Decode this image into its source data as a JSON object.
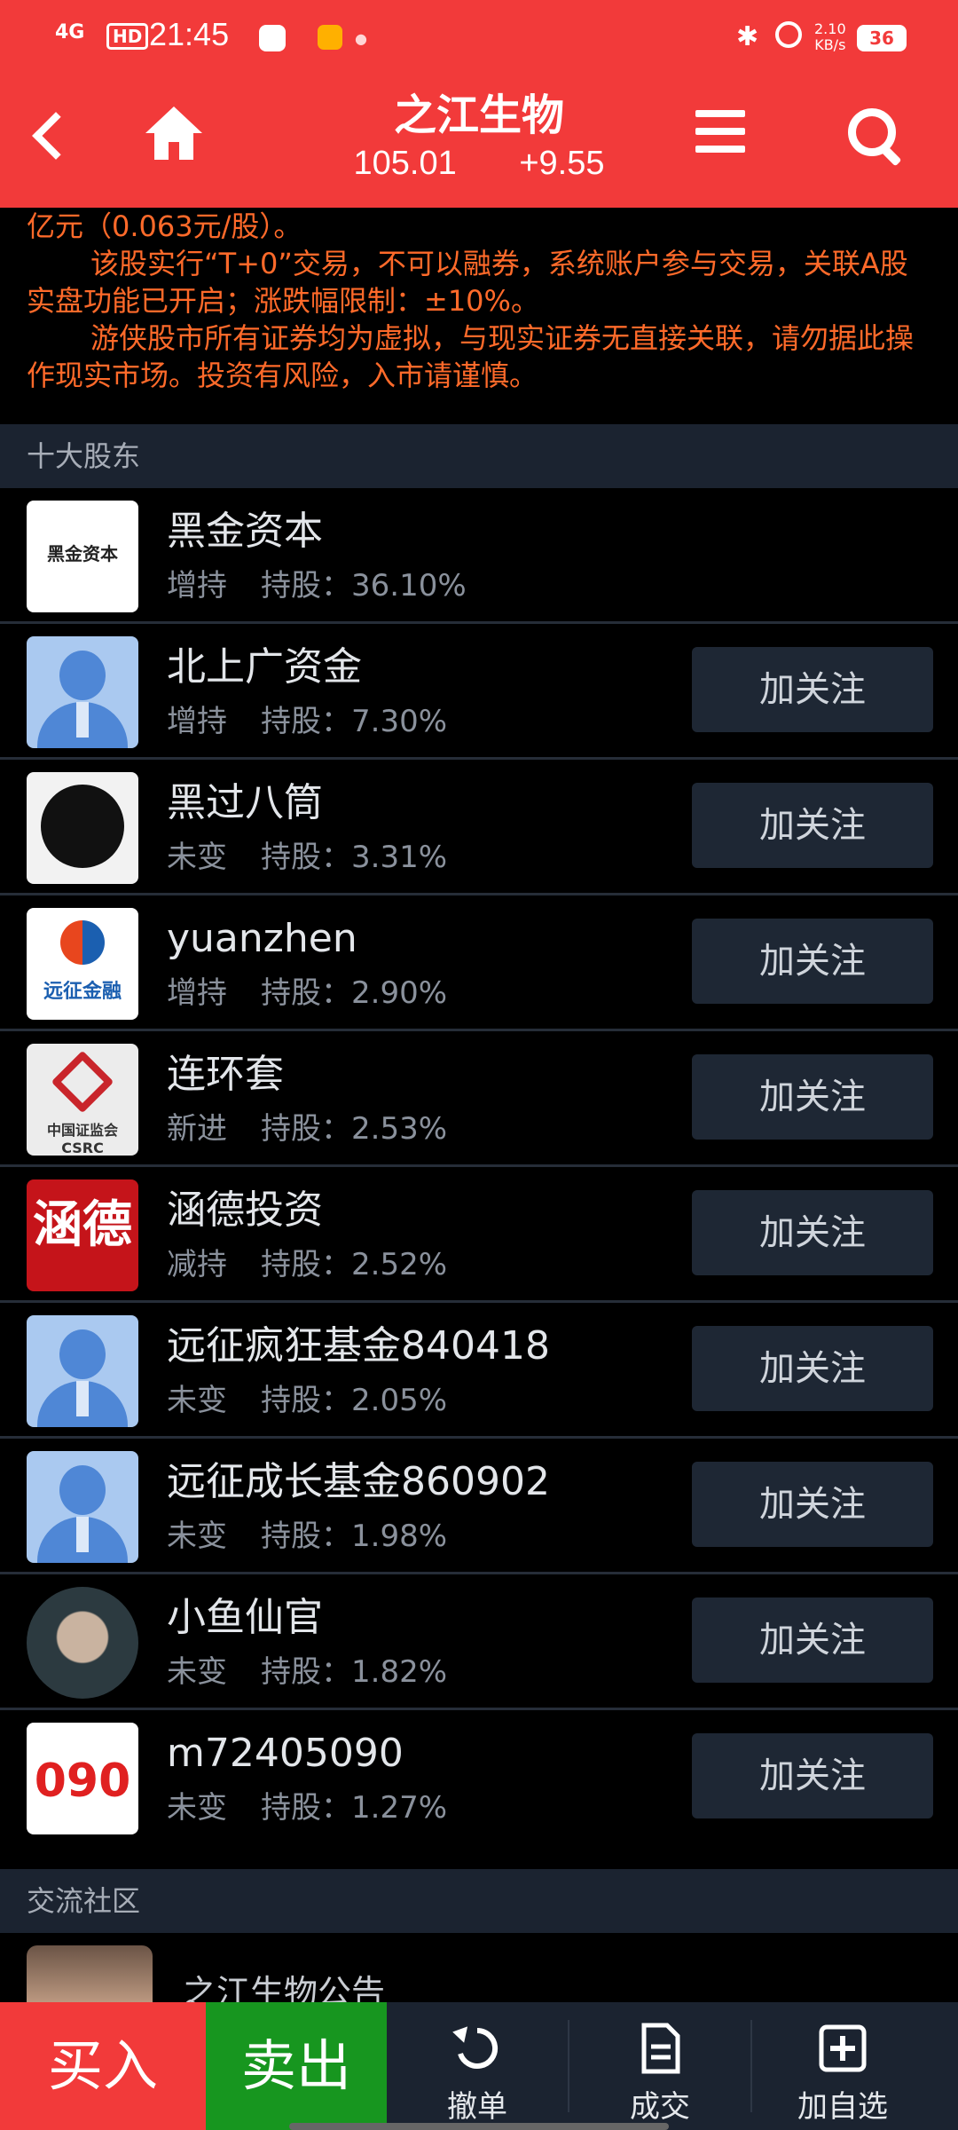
{
  "status_bar": {
    "network": "4G",
    "hd": "HD",
    "time": "21:45",
    "speed_value": "2.10",
    "speed_unit": "KB/s",
    "battery": "36"
  },
  "header": {
    "title": "之江生物",
    "price": "105.01",
    "change": "+9.55",
    "icons": [
      "back-icon",
      "home-icon",
      "menu-icon",
      "search-icon"
    ]
  },
  "notice": {
    "line1": "亿元（0.063元/股）。",
    "line2": "该股实行“T+0”交易，不可以融券，系统账户参与交易，关联A股实盘功能已开启；涨跌幅限制：±10%。",
    "line3": "游侠股市所有证券均为虚拟，与现实证券无直接关联，请勿据此操作现实市场。投资有风险，入市请谨慎。"
  },
  "shareholders": {
    "section_title": "十大股东",
    "share_label": "持股：",
    "follow_label": "加关注",
    "items": [
      {
        "name": "黑金资本",
        "action": "增持",
        "share": "36.10%",
        "avatar": "heijin-logo",
        "avatar_text": "黑金资本",
        "follow": false
      },
      {
        "name": "北上广资金",
        "action": "增持",
        "share": "7.30%",
        "avatar": "default-person",
        "follow": true
      },
      {
        "name": "黑过八筒",
        "action": "未变",
        "share": "3.31%",
        "avatar": "bear",
        "follow": true
      },
      {
        "name": "yuanzhen",
        "action": "增持",
        "share": "2.90%",
        "avatar": "yuanzheng-logo",
        "avatar_text": "远征金融",
        "follow": true
      },
      {
        "name": "连环套",
        "action": "新进",
        "share": "2.53%",
        "avatar": "csrc-logo",
        "avatar_text": "中国证监会 CSRC",
        "follow": true
      },
      {
        "name": "涵德投资",
        "action": "减持",
        "share": "2.52%",
        "avatar": "hande-logo",
        "avatar_text": "涵德",
        "follow": true
      },
      {
        "name": "远征疯狂基金840418",
        "action": "未变",
        "share": "2.05%",
        "avatar": "default-person",
        "follow": true
      },
      {
        "name": "远征成长基金860902",
        "action": "未变",
        "share": "1.98%",
        "avatar": "default-person",
        "follow": true
      },
      {
        "name": "小鱼仙官",
        "action": "未变",
        "share": "1.82%",
        "avatar": "photo",
        "follow": true
      },
      {
        "name": "m72405090",
        "action": "未变",
        "share": "1.27%",
        "avatar": "number-logo",
        "avatar_text": "090",
        "follow": true
      }
    ]
  },
  "community": {
    "section_title": "交流社区",
    "first_post_title": "之江生物公告"
  },
  "bottom_bar": {
    "buy": "买入",
    "sell": "卖出",
    "tabs": [
      {
        "label": "撤单",
        "icon": "undo-icon"
      },
      {
        "label": "成交",
        "icon": "document-icon"
      },
      {
        "label": "加自选",
        "icon": "add-box-icon"
      }
    ]
  }
}
